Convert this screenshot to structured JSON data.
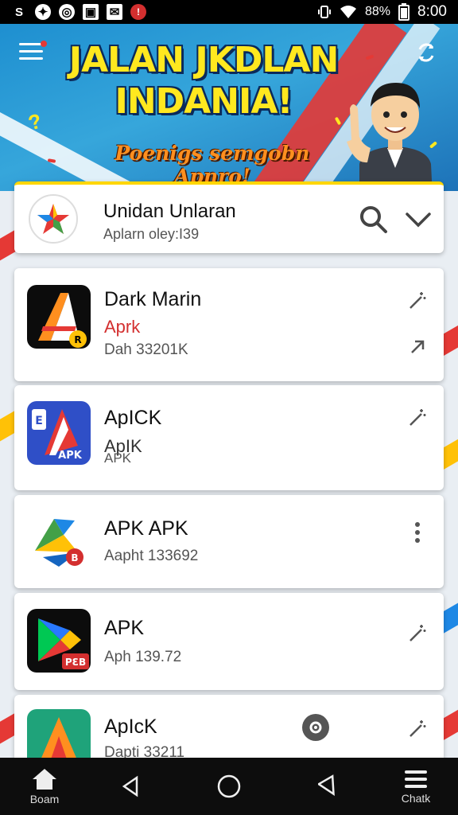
{
  "status_bar": {
    "left_icons": [
      "S",
      "✦",
      "◎",
      "▣",
      "✉",
      "!"
    ],
    "battery_percent": "88%",
    "time": "8:00"
  },
  "banner": {
    "title_line1": "JALAN JKDLAN",
    "title_line2": "INDANIA!",
    "subtitle": "Poenigs semgobn Apnro!"
  },
  "header": {
    "title": "Unidan Unlaran",
    "subtitle": "Aplarn oley:I39"
  },
  "apps": [
    {
      "name": "Dark Marin",
      "line1": "Aprk",
      "line2": "Dah 33201K"
    },
    {
      "name": "ApICK",
      "line1": "ApIK",
      "line2": "APK"
    },
    {
      "name": "APK APK",
      "line1": "Aapht 133692"
    },
    {
      "name": "APK",
      "line1": "Aph 139.72"
    },
    {
      "name": "ApIcK",
      "line1": "Dapti 33211"
    }
  ],
  "app_icon_badges": {
    "apk_label": "APK",
    "pb_label": "PƐB",
    "b_label": "B"
  },
  "bottom_nav": {
    "home_label": "Boam",
    "menu_label": "Chatk"
  },
  "colors": {
    "banner_blue": "#1e8fd0",
    "title_yellow": "#ffe81f",
    "subtitle_orange": "#ff8f1f",
    "accent_red": "#e53935",
    "header_border": "#ffd600"
  }
}
